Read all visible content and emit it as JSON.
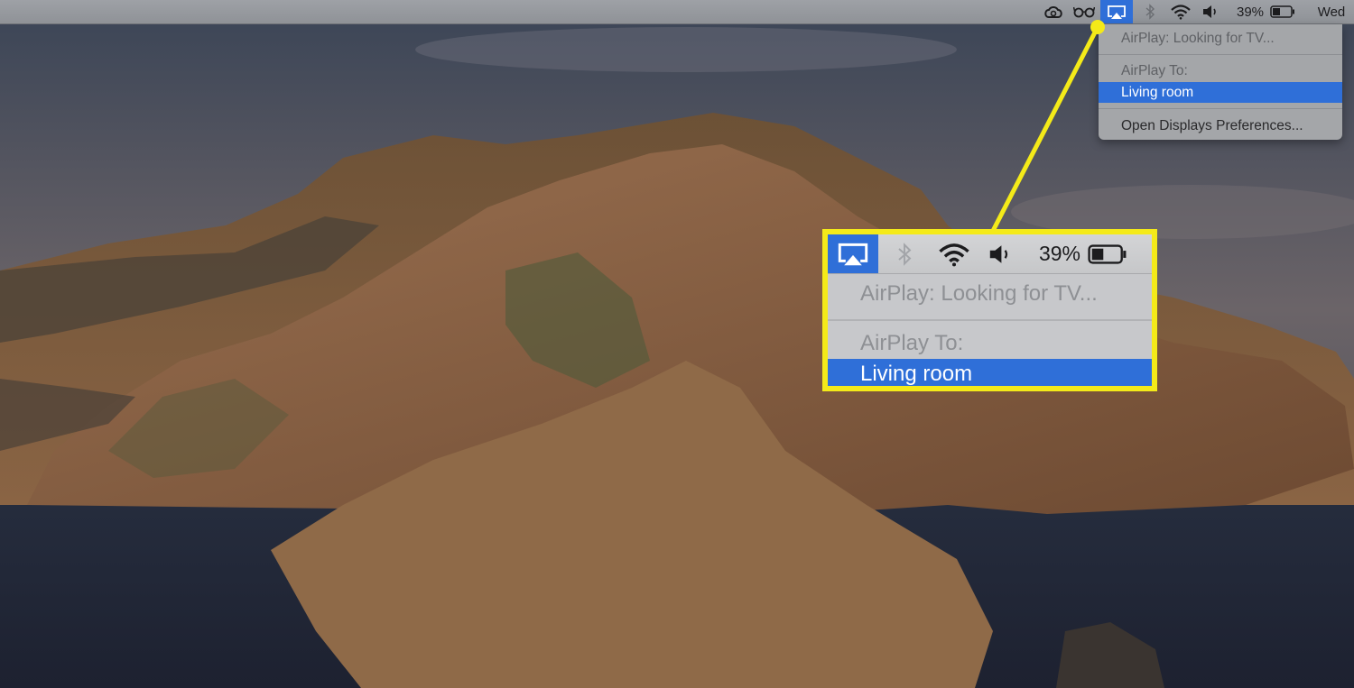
{
  "menubar": {
    "battery_percent": "39%",
    "clock": "Wed",
    "icons": [
      "creative-cloud-icon",
      "glasses-icon",
      "airplay-icon",
      "bluetooth-icon",
      "wifi-icon",
      "volume-icon",
      "battery-icon"
    ]
  },
  "airplay_menu": {
    "status": "AirPlay: Looking for TV...",
    "section_header": "AirPlay To:",
    "selected_device": "Living room",
    "preferences_item": "Open Displays Preferences..."
  },
  "callout": {
    "battery_percent": "39%",
    "status": "AirPlay: Looking for TV...",
    "section_header": "AirPlay To:",
    "selected_device": "Living room"
  },
  "colors": {
    "highlight": "#2f6fd8",
    "callout_border": "#f4ea19"
  }
}
